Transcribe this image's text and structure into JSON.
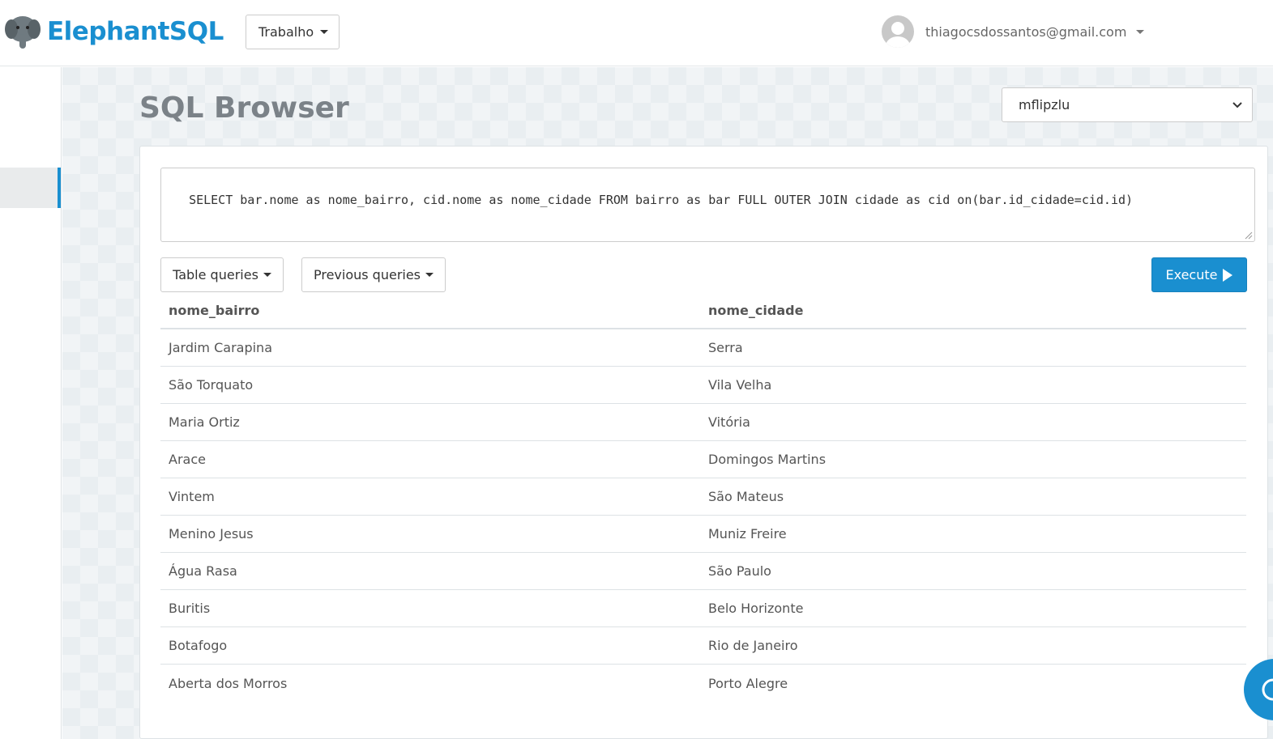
{
  "brand": {
    "name": "ElephantSQL",
    "accent": "#1a8fd0"
  },
  "team": {
    "label": "Trabalho"
  },
  "user": {
    "email": "thiagocsdossantos@gmail.com"
  },
  "page": {
    "title": "SQL Browser"
  },
  "database": {
    "selected": "mflipzlu"
  },
  "query": {
    "text": "SELECT bar.nome as nome_bairro, cid.nome as nome_cidade FROM bairro as bar FULL OUTER JOIN cidade as cid on(bar.id_cidade=cid.id)"
  },
  "toolbar": {
    "table_queries": "Table queries",
    "previous_queries": "Previous queries",
    "execute": "Execute"
  },
  "results": {
    "columns": [
      "nome_bairro",
      "nome_cidade"
    ],
    "rows": [
      [
        "Jardim Carapina",
        "Serra"
      ],
      [
        "São Torquato",
        "Vila Velha"
      ],
      [
        "Maria Ortiz",
        "Vitória"
      ],
      [
        "Arace",
        "Domingos Martins"
      ],
      [
        "Vintem",
        "São Mateus"
      ],
      [
        "Menino Jesus",
        "Muniz Freire"
      ],
      [
        "Água Rasa",
        "São Paulo"
      ],
      [
        "Buritis",
        "Belo Horizonte"
      ],
      [
        "Botafogo",
        "Rio de Janeiro"
      ],
      [
        "Aberta dos Morros",
        "Porto Alegre"
      ]
    ]
  }
}
